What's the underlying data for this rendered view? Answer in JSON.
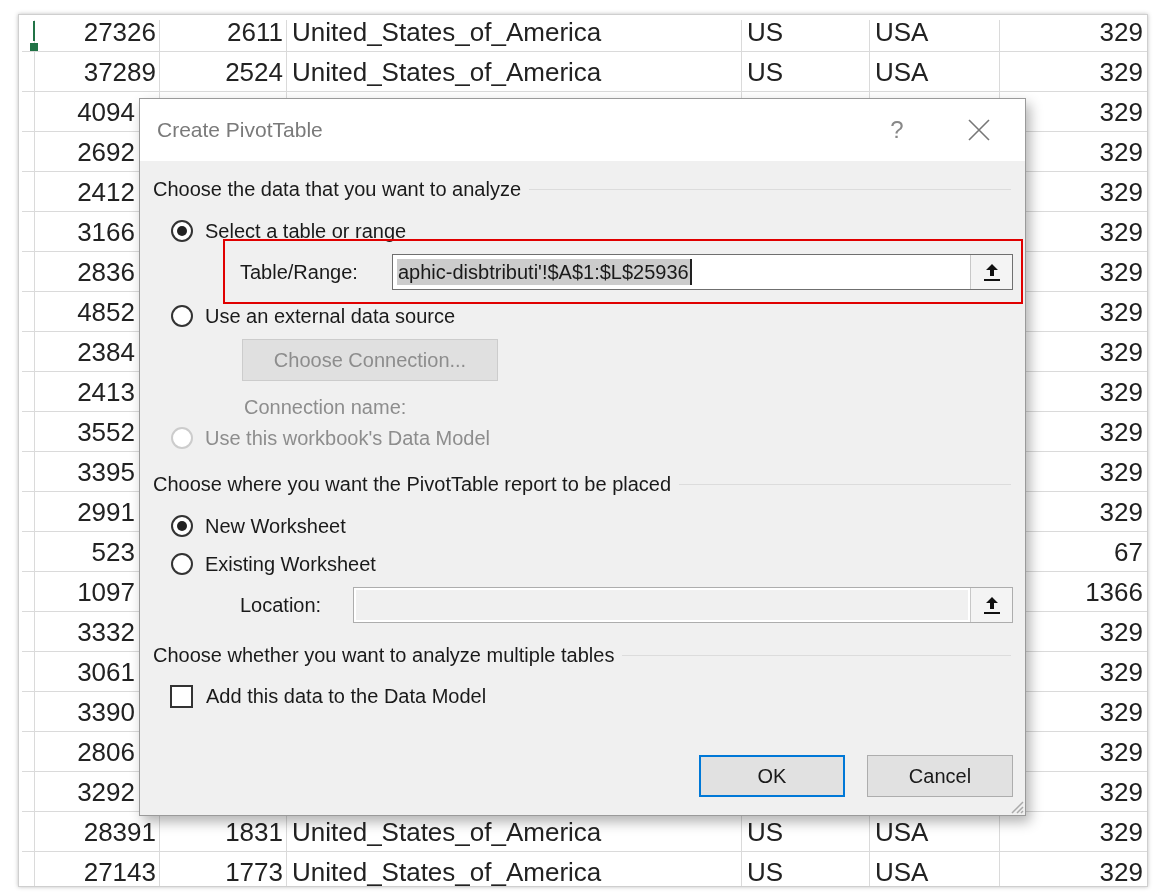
{
  "spreadsheet": {
    "rows": [
      {
        "column_1": "27326",
        "column_2": "2611",
        "column_3": "United_States_of_America",
        "column_4": "US",
        "column_5": "USA",
        "column_6": "329"
      },
      {
        "column_1": "37289",
        "column_2": "2524",
        "column_3": "United_States_of_America",
        "column_4": "US",
        "column_5": "USA",
        "column_6": "329"
      },
      {
        "column_1": "4094",
        "column_6": "329"
      },
      {
        "column_1": "2692",
        "column_6": "329"
      },
      {
        "column_1": "2412",
        "column_6": "329"
      },
      {
        "column_1": "3166",
        "column_6": "329"
      },
      {
        "column_1": "2836",
        "column_6": "329"
      },
      {
        "column_1": "4852",
        "column_6": "329"
      },
      {
        "column_1": "2384",
        "column_6": "329"
      },
      {
        "column_1": "2413",
        "column_6": "329"
      },
      {
        "column_1": "3552",
        "column_6": "329"
      },
      {
        "column_1": "3395",
        "column_6": "329"
      },
      {
        "column_1": "2991",
        "column_6": "329"
      },
      {
        "column_1": "523",
        "column_6": "67"
      },
      {
        "column_1": "1097",
        "column_6": "1366"
      },
      {
        "column_1": "3332",
        "column_6": "329"
      },
      {
        "column_1": "3061",
        "column_6": "329"
      },
      {
        "column_1": "3390",
        "column_6": "329"
      },
      {
        "column_1": "2806",
        "column_6": "329"
      },
      {
        "column_1": "3292",
        "column_6": "329"
      },
      {
        "column_1": "28391",
        "column_2": "1831",
        "column_3": "United_States_of_America",
        "column_4": "US",
        "column_5": "USA",
        "column_6": "329"
      },
      {
        "column_1": "27143",
        "column_2": "1773",
        "column_3": "United_States_of_America",
        "column_4": "US",
        "column_5": "USA",
        "column_6": "329"
      }
    ]
  },
  "dialog": {
    "title": "Create PivotTable",
    "help_button": "?",
    "items": [
      {
        "kind": "heading",
        "text": "Choose the data that you want to analyze"
      },
      {
        "kind": "radio",
        "label": "Select a table or range",
        "selected": true,
        "disabled": false
      },
      {
        "kind": "range_field",
        "label": "Table/Range:",
        "value": "aphic-disbtributi'!$A$1:$L$25936",
        "text_selected": true,
        "highlighted": true,
        "disabled": false
      },
      {
        "kind": "radio",
        "label": "Use an external data source",
        "selected": false,
        "disabled": false
      },
      {
        "kind": "button",
        "label": "Choose Connection...",
        "disabled": true
      },
      {
        "kind": "note",
        "text": "Connection name:",
        "disabled": true
      },
      {
        "kind": "radio",
        "label": "Use this workbook's Data Model",
        "selected": false,
        "disabled": true
      },
      {
        "kind": "heading",
        "text": "Choose where you want the PivotTable report to be placed"
      },
      {
        "kind": "radio",
        "label": "New Worksheet",
        "selected": true,
        "disabled": false
      },
      {
        "kind": "radio",
        "label": "Existing Worksheet",
        "selected": false,
        "disabled": false
      },
      {
        "kind": "range_field",
        "label": "Location:",
        "text_selected": false,
        "highlighted": false,
        "disabled": true
      },
      {
        "kind": "heading",
        "text": "Choose whether you want to analyze multiple tables"
      },
      {
        "kind": "checkbox",
        "label": "Add this data to the Data Model",
        "checked": false
      }
    ],
    "buttons": [
      {
        "label": "OK",
        "default": true
      },
      {
        "label": "Cancel",
        "default": false
      }
    ]
  }
}
